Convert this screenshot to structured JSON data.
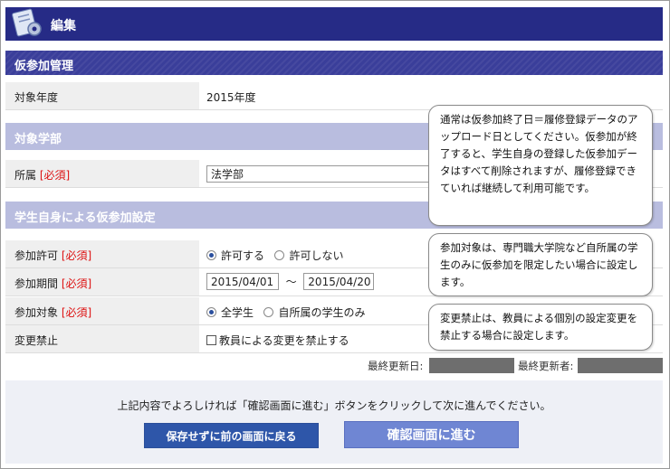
{
  "header": {
    "title": "編集",
    "logo_icon": "gear-document-icon"
  },
  "sections": {
    "provisional": "仮参加管理",
    "target_faculty": "対象学部",
    "self_settings": "学生自身による仮参加設定"
  },
  "rows": {
    "year": {
      "label": "対象年度",
      "value": "2015年度"
    },
    "affiliation": {
      "label": "所属",
      "required": "[必須]",
      "value": "法学部"
    },
    "permission": {
      "label": "参加許可",
      "required": "[必須]",
      "opt_allow": "許可する",
      "opt_deny": "許可しない",
      "selected": "許可する"
    },
    "period": {
      "label": "参加期間",
      "required": "[必須]",
      "start": "2015/04/01",
      "separator": "～",
      "end": "2015/04/20"
    },
    "target": {
      "label": "参加対象",
      "required": "[必須]",
      "opt_all": "全学生",
      "opt_own": "自所属の学生のみ",
      "selected": "全学生"
    },
    "change_lock": {
      "label": "変更禁止",
      "checkbox_label": "教員による変更を禁止する",
      "checked": false
    }
  },
  "tooltips": {
    "end_date": "通常は仮参加終了日＝履修登録データのアップロード日としてください。仮参加が終了すると、学生自身の登録した仮参加データはすべて削除されますが、履修登録できていれば継続して利用可能です。",
    "target": "参加対象は、専門職大学院など自所属の学生のみに仮参加を限定したい場合に設定します。",
    "change_lock": "変更禁止は、教員による個別の設定変更を禁止する場合に設定します。"
  },
  "meta": {
    "updated_label": "最終更新日:",
    "updater_label": "最終更新者:"
  },
  "footer": {
    "note": "上記内容でよろしければ「確認画面に進む」ボタンをクリックして次に進んでください。",
    "back_label": "保存せずに前の画面に戻る",
    "next_label": "確認画面に進む"
  },
  "colors": {
    "header": "#262b86",
    "section": "#3a3e9a",
    "section_light": "#b9bddf",
    "required": "#dd1111",
    "button_back": "#2e56a9",
    "button_next": "#6f86d3"
  }
}
